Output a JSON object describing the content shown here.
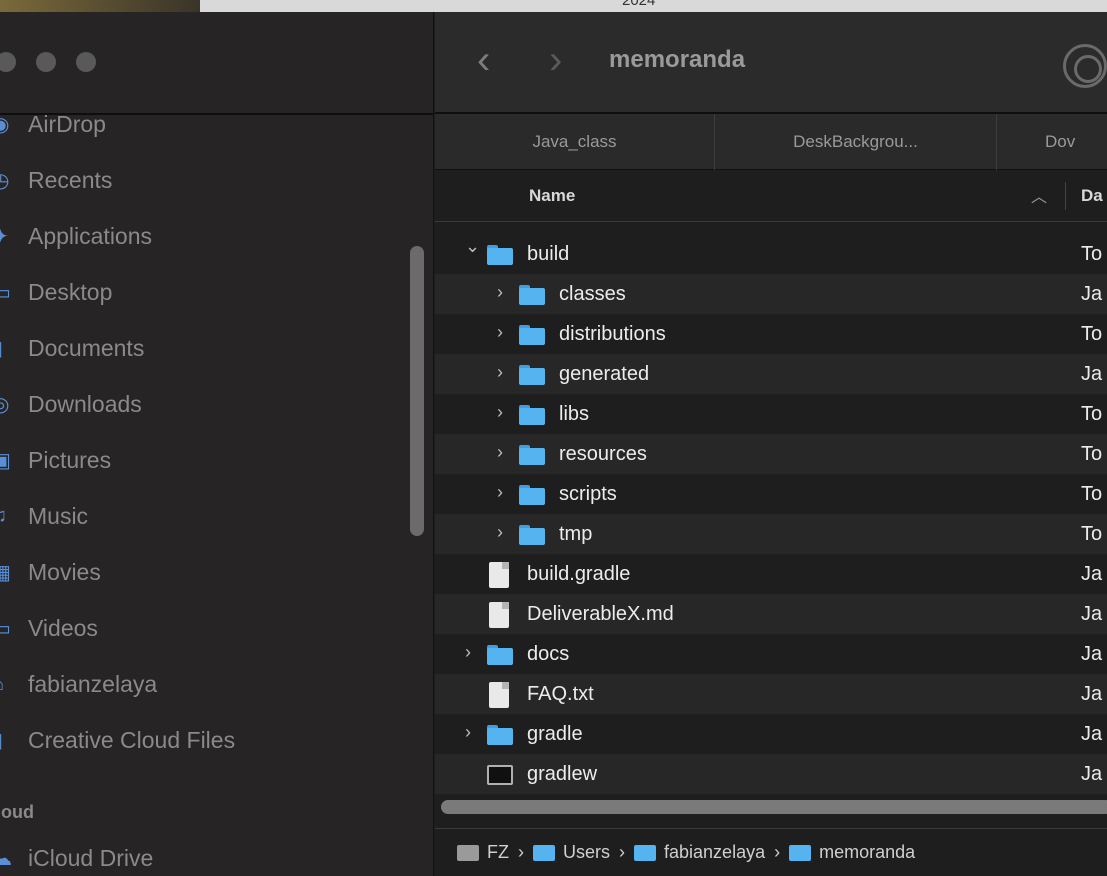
{
  "background_year": "2024",
  "window": {
    "title": "memoranda"
  },
  "sidebar": {
    "items": [
      {
        "label": "AirDrop",
        "icon": "airdrop-icon"
      },
      {
        "label": "Recents",
        "icon": "clock-icon"
      },
      {
        "label": "Applications",
        "icon": "applications-icon"
      },
      {
        "label": "Desktop",
        "icon": "desktop-icon"
      },
      {
        "label": "Documents",
        "icon": "document-icon"
      },
      {
        "label": "Downloads",
        "icon": "download-icon"
      },
      {
        "label": "Pictures",
        "icon": "photo-icon"
      },
      {
        "label": "Music",
        "icon": "music-icon"
      },
      {
        "label": "Movies",
        "icon": "film-icon"
      },
      {
        "label": "Videos",
        "icon": "folder-icon"
      },
      {
        "label": "fabianzelaya",
        "icon": "home-icon"
      },
      {
        "label": "Creative Cloud Files",
        "icon": "file-icon"
      }
    ],
    "section_label": "loud",
    "icloud_item": {
      "label": "iCloud Drive",
      "icon": "cloud-icon"
    }
  },
  "tabs": [
    "Java_class",
    "DeskBackgrou...",
    "Dov"
  ],
  "columns": {
    "name": "Name",
    "date": "Da"
  },
  "rows": [
    {
      "name": "build",
      "kind": "folder",
      "expanded": true,
      "indent": 0,
      "date": "To"
    },
    {
      "name": "classes",
      "kind": "folder",
      "expanded": false,
      "indent": 1,
      "date": "Ja"
    },
    {
      "name": "distributions",
      "kind": "folder",
      "expanded": false,
      "indent": 1,
      "date": "To"
    },
    {
      "name": "generated",
      "kind": "folder",
      "expanded": false,
      "indent": 1,
      "date": "Ja"
    },
    {
      "name": "libs",
      "kind": "folder",
      "expanded": false,
      "indent": 1,
      "date": "To"
    },
    {
      "name": "resources",
      "kind": "folder",
      "expanded": false,
      "indent": 1,
      "date": "To"
    },
    {
      "name": "scripts",
      "kind": "folder",
      "expanded": false,
      "indent": 1,
      "date": "To"
    },
    {
      "name": "tmp",
      "kind": "folder",
      "expanded": false,
      "indent": 1,
      "date": "To"
    },
    {
      "name": "build.gradle",
      "kind": "file",
      "indent": 0,
      "date": "Ja"
    },
    {
      "name": "DeliverableX.md",
      "kind": "file",
      "indent": 0,
      "date": "Ja"
    },
    {
      "name": "docs",
      "kind": "folder",
      "expanded": false,
      "indent": 0,
      "date": "Ja"
    },
    {
      "name": "FAQ.txt",
      "kind": "file",
      "indent": 0,
      "date": "Ja"
    },
    {
      "name": "gradle",
      "kind": "folder",
      "expanded": false,
      "indent": 0,
      "date": "Ja"
    },
    {
      "name": "gradlew",
      "kind": "executable",
      "indent": 0,
      "date": "Ja"
    }
  ],
  "path": [
    {
      "label": "FZ",
      "icon": "disk-icon"
    },
    {
      "label": "Users",
      "icon": "folder-icon"
    },
    {
      "label": "fabianzelaya",
      "icon": "home-folder-icon"
    },
    {
      "label": "memoranda",
      "icon": "folder-icon"
    }
  ],
  "path_separator": "›",
  "colors": {
    "folder": "#55b3f0",
    "sidebar_icon": "#5a8fd6",
    "background": "#1e1e1e"
  }
}
